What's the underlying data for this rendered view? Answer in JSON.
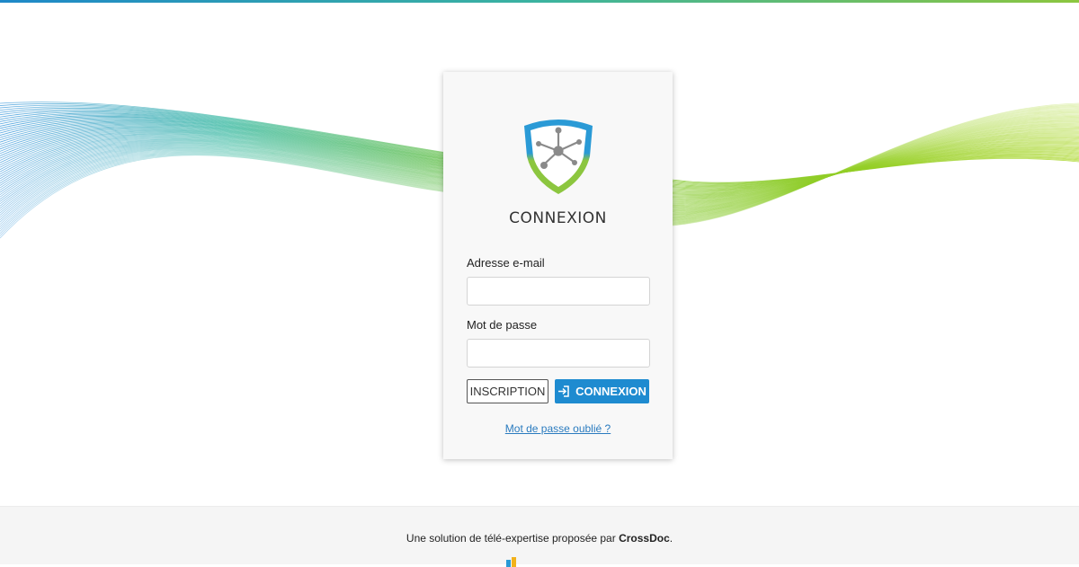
{
  "login": {
    "title": "CONNEXION",
    "email_label": "Adresse e-mail",
    "email_value": "",
    "password_label": "Mot de passe",
    "password_value": "",
    "register_label": "INSCRIPTION",
    "login_label": "CONNEXION",
    "forgot_label": "Mot de passe oublié ?"
  },
  "footer": {
    "text_prefix": "Une solution de télé-expertise proposée par ",
    "brand": "CrossDoc",
    "text_suffix": "."
  },
  "colors": {
    "primary_blue": "#1e8bd0",
    "brand_green": "#8cc63f",
    "link": "#2a7bbf"
  },
  "icons": {
    "logo": "shield-network-logo",
    "login": "sign-in-icon",
    "footer_logo": "crossdoc-logo"
  }
}
